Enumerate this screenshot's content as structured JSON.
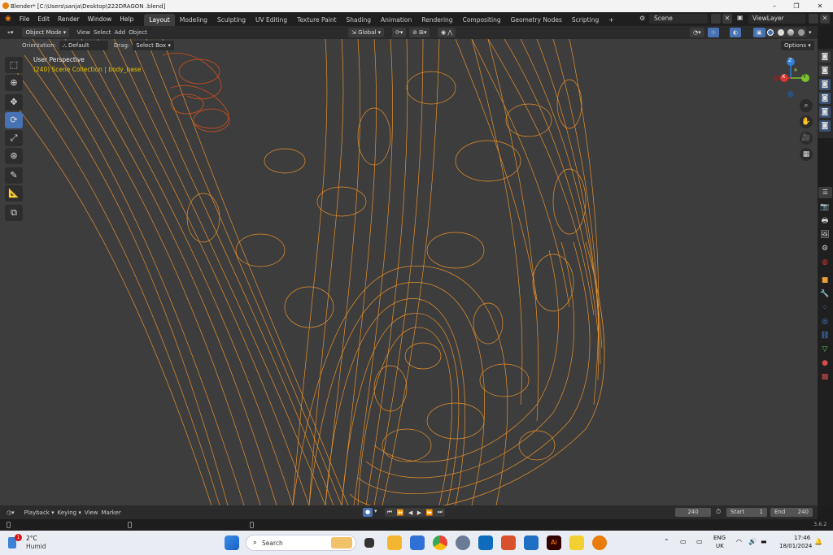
{
  "window": {
    "title": "Blender* [C:\\Users\\sanja\\Desktop\\222DRAGON .blend]",
    "minimize": "–",
    "restore": "❐",
    "close": "✕"
  },
  "menus": [
    "File",
    "Edit",
    "Render",
    "Window",
    "Help"
  ],
  "workspaces": [
    "Layout",
    "Modeling",
    "Sculpting",
    "UV Editing",
    "Texture Paint",
    "Shading",
    "Animation",
    "Rendering",
    "Compositing",
    "Geometry Nodes",
    "Scripting"
  ],
  "workspace_add": "+",
  "scene": {
    "label": "Scene",
    "viewlayer": "ViewLayer"
  },
  "header": {
    "mode": "Object Mode",
    "view_menus": [
      "View",
      "Select",
      "Add",
      "Object"
    ],
    "transform_orientation": "Global",
    "options": "Options"
  },
  "tool_settings": {
    "orientation_label": "Orientation:",
    "orientation_value": "Default",
    "drag_label": "Drag:",
    "drag_value": "Select Box"
  },
  "viewport": {
    "perspective": "User Perspective",
    "collection_info": "(240) Scene Collection | body_base",
    "gizmo_axes": [
      "Z",
      "X",
      "Y"
    ]
  },
  "timeline": {
    "menus": [
      "Playback",
      "Keying",
      "View",
      "Marker"
    ],
    "current_frame": "240",
    "start_label": "Start",
    "start_value": "1",
    "end_label": "End",
    "end_value": "240"
  },
  "version": "3.6.2",
  "taskbar": {
    "weather_temp": "2°C",
    "weather_desc": "Humid",
    "weather_badge": "1",
    "search_placeholder": "Search",
    "lang_top": "ENG",
    "lang_bottom": "UK",
    "time": "17:46",
    "date": "18/01/2024"
  },
  "colors": {
    "accent": "#4772b3",
    "wire": "#f0952c",
    "wire_selected": "#e0501a",
    "viewport_bg": "#3d3d3d",
    "collection_text": "#e6c200"
  }
}
